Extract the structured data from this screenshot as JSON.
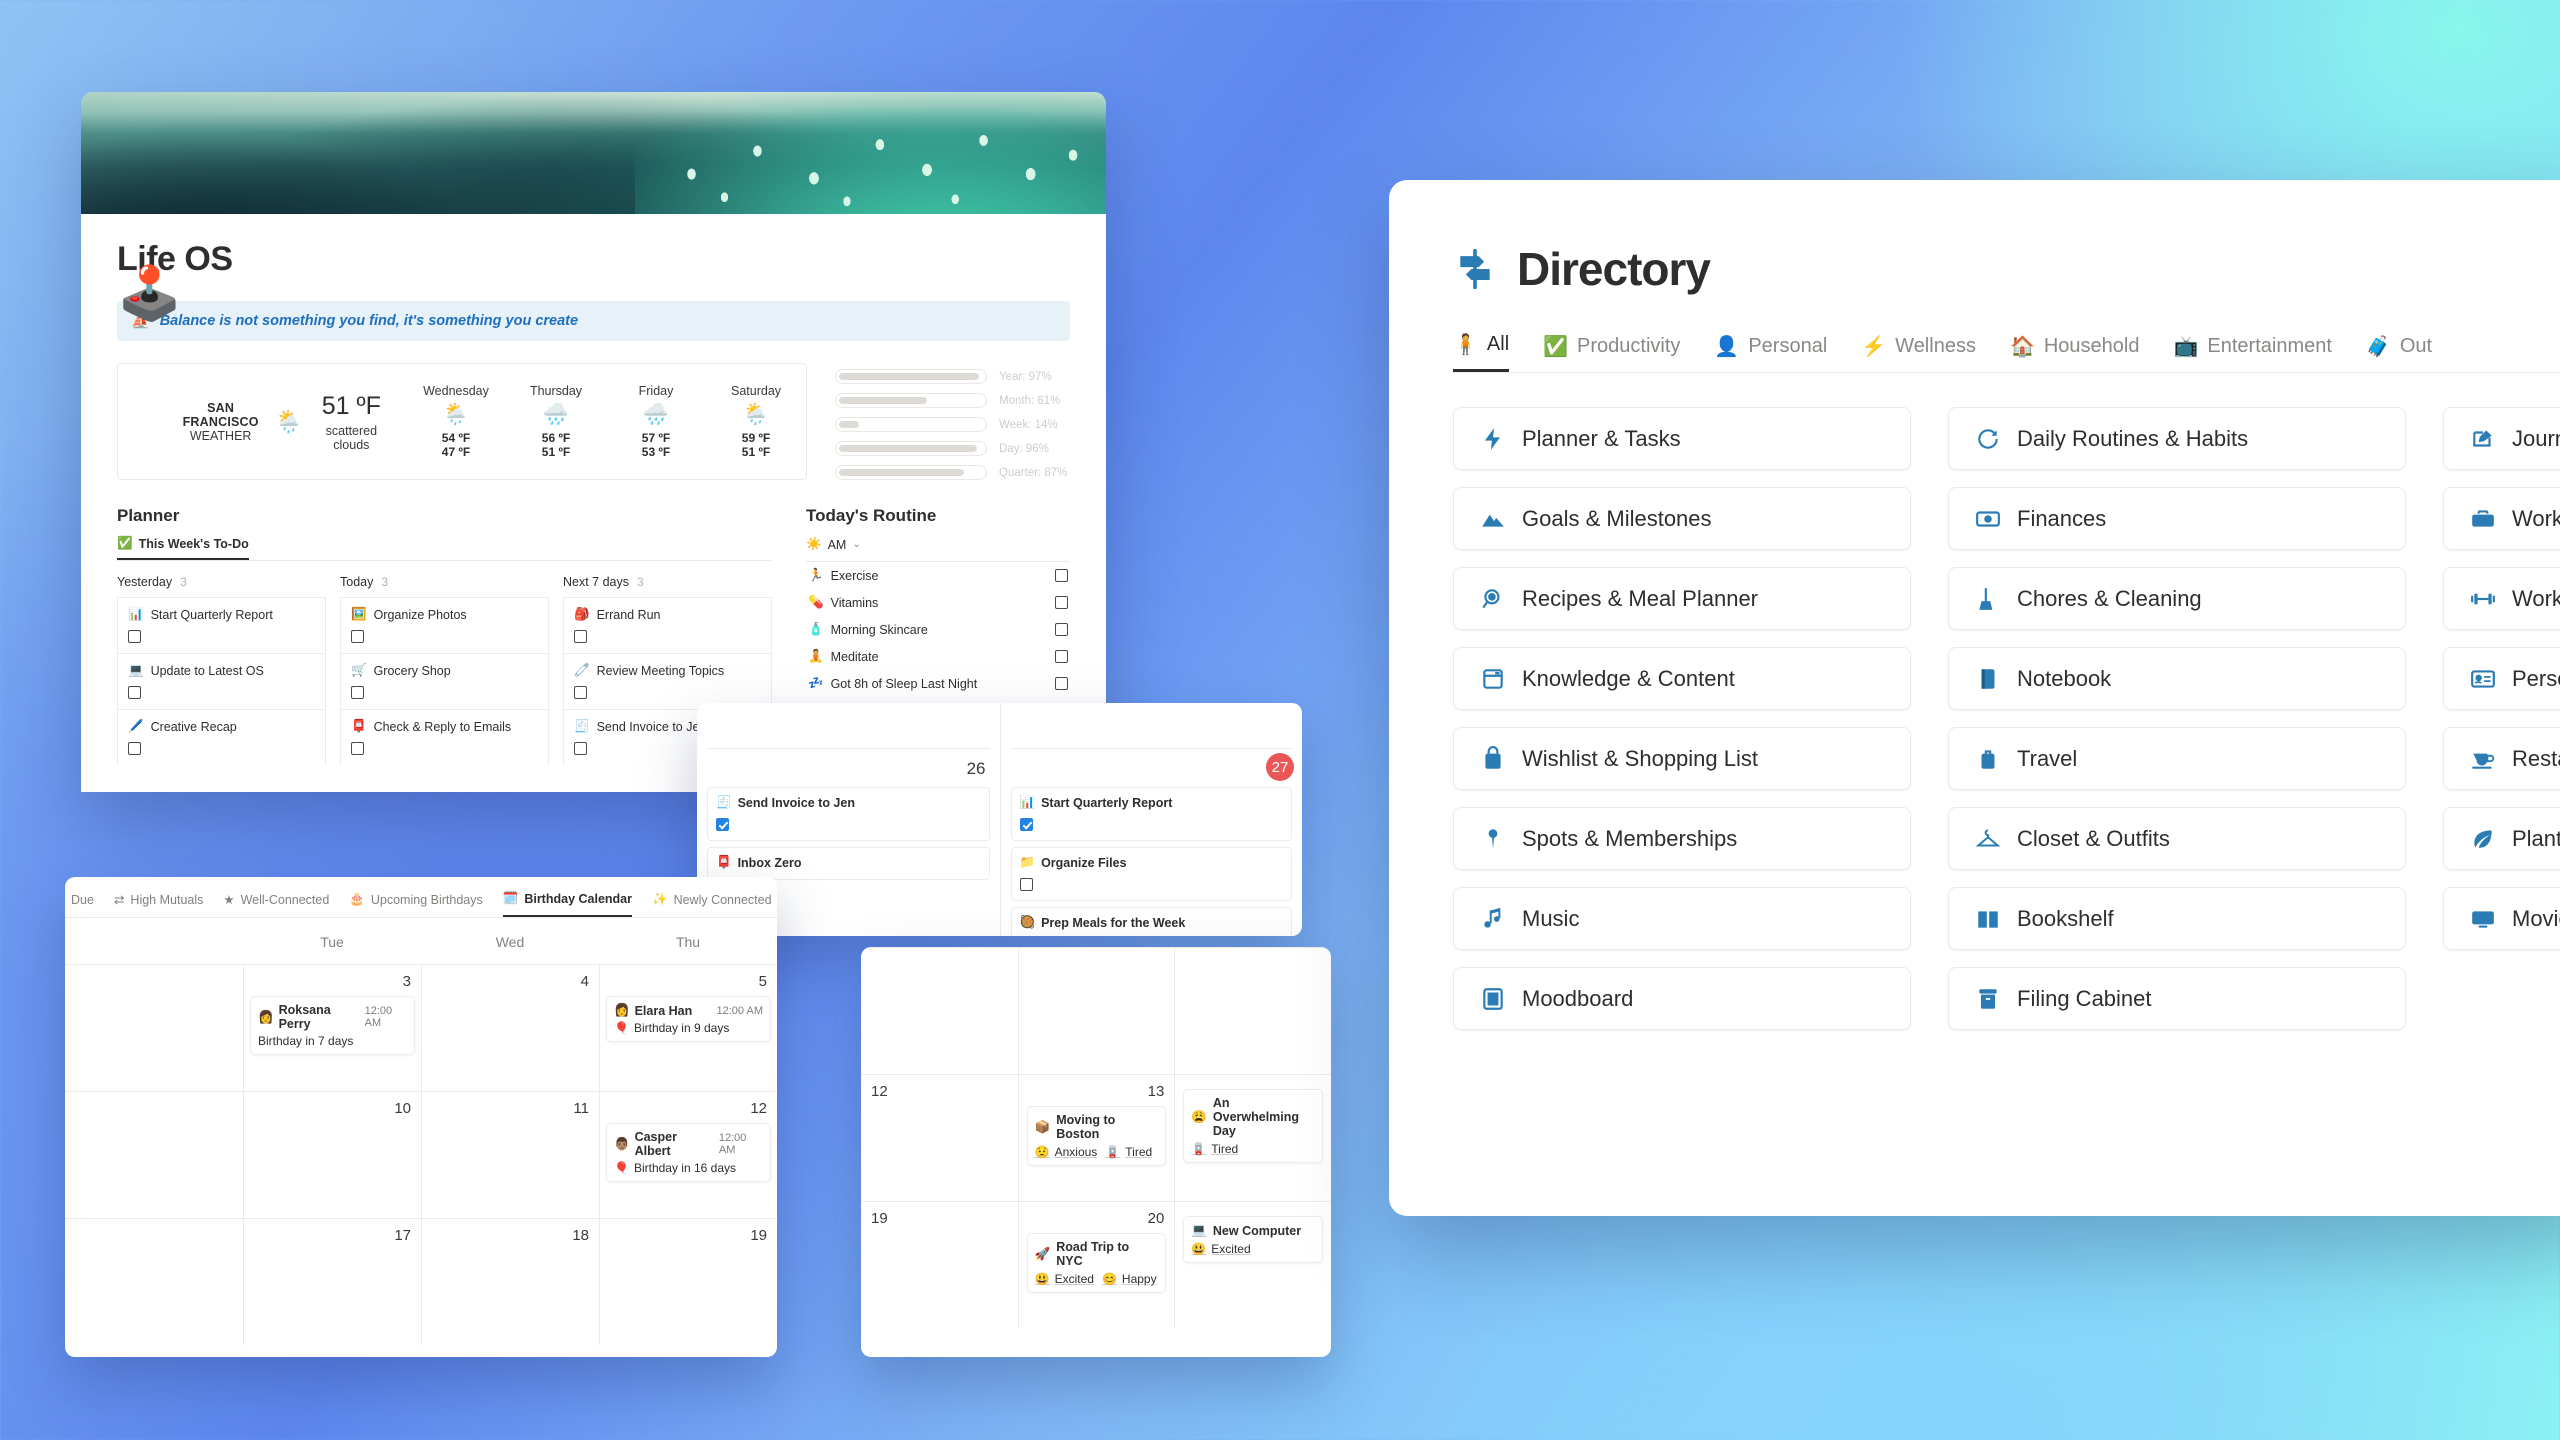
{
  "background": {
    "from": "#8fc3f3",
    "mid": "#5d87ef",
    "to": "#8ffaf0"
  },
  "lifeos": {
    "title": "Life OS",
    "cover_icon": "joystick-icon",
    "callout": {
      "icon": "boat-icon",
      "text": "Balance is not something you find, it's something you create"
    },
    "weather": {
      "city": "SAN FRANCISCO",
      "label": "WEATHER",
      "now_icon": "sun-behind-rain-cloud-icon",
      "temperature": "51 ºF",
      "description": "scattered clouds",
      "forecast": [
        {
          "day": "Wednesday",
          "icon": "sun-behind-rain-cloud-icon",
          "high": "54 ºF",
          "low": "47 ºF"
        },
        {
          "day": "Thursday",
          "icon": "rain-cloud-icon",
          "high": "56 ºF",
          "low": "51 ºF"
        },
        {
          "day": "Friday",
          "icon": "rain-cloud-icon",
          "high": "57 ºF",
          "low": "53 ºF"
        },
        {
          "day": "Saturday",
          "icon": "sun-behind-rain-cloud-icon",
          "high": "59 ºF",
          "low": "51 ºF"
        }
      ]
    },
    "progress": [
      {
        "label": "Year: 97%",
        "percent": 97
      },
      {
        "label": "Month: 61%",
        "percent": 61
      },
      {
        "label": "Week: 14%",
        "percent": 14
      },
      {
        "label": "Day: 96%",
        "percent": 96
      },
      {
        "label": "Quarter: 87%",
        "percent": 87
      }
    ],
    "planner": {
      "title": "Planner",
      "tab": {
        "icon": "check-circle-icon",
        "label": "This Week's To-Do"
      },
      "columns": [
        {
          "name": "Yesterday",
          "count": "3",
          "tasks": [
            {
              "icon": "bar-chart-icon",
              "label": "Start Quarterly Report",
              "checked": false
            },
            {
              "icon": "computer-icon",
              "label": "Update to Latest OS",
              "checked": false
            },
            {
              "icon": "pen-icon",
              "label": "Creative Recap",
              "checked": false
            }
          ]
        },
        {
          "name": "Today",
          "count": "3",
          "tasks": [
            {
              "icon": "framed-picture-icon",
              "label": "Organize Photos",
              "checked": false
            },
            {
              "icon": "shopping-cart-icon",
              "label": "Grocery Shop",
              "checked": false
            },
            {
              "icon": "mailbox-icon",
              "label": "Check & Reply to Emails",
              "checked": false
            }
          ]
        },
        {
          "name": "Next 7 days",
          "count": "3",
          "tasks": [
            {
              "icon": "backpack-icon",
              "label": "Errand Run",
              "checked": false
            },
            {
              "icon": "memo-icon",
              "label": "Review Meeting Topics",
              "checked": false
            },
            {
              "icon": "receipt-icon",
              "label": "Send Invoice to Jen",
              "checked": false
            }
          ]
        }
      ]
    },
    "routine": {
      "title": "Today's Routine",
      "selector": {
        "icon": "sun-icon",
        "label": "AM",
        "chevron": "chevron-down-icon"
      },
      "items": [
        {
          "icon": "running-icon",
          "label": "Exercise",
          "checked": false
        },
        {
          "icon": "pill-icon",
          "label": "Vitamins",
          "checked": false
        },
        {
          "icon": "lotion-icon",
          "label": "Morning Skincare",
          "checked": false
        },
        {
          "icon": "meditation-icon",
          "label": "Meditate",
          "checked": false
        },
        {
          "icon": "sleep-icon",
          "label": "Got 8h of Sleep Last Night",
          "checked": false
        }
      ]
    }
  },
  "week_calendar": {
    "days": [
      {
        "number": "26",
        "is_today": false,
        "events": [
          {
            "icon": "receipt-icon",
            "label": "Send Invoice to Jen",
            "checked": true
          },
          {
            "icon": "mailbox-icon",
            "label": "Inbox Zero",
            "checked": false
          }
        ]
      },
      {
        "number": "27",
        "is_today": true,
        "events": [
          {
            "icon": "bar-chart-icon",
            "label": "Start Quarterly Report",
            "checked": true
          },
          {
            "icon": "folder-icon",
            "label": "Organize Files",
            "checked": false
          },
          {
            "icon": "cooking-icon",
            "label": "Prep Meals for the Week",
            "checked": false
          }
        ]
      }
    ]
  },
  "birthday_calendar": {
    "tabs": [
      {
        "icon": "",
        "label": "Due",
        "active": false
      },
      {
        "icon": "shuffle-icon",
        "label": "High Mutuals",
        "active": false
      },
      {
        "icon": "star-icon",
        "label": "Well-Connected",
        "active": false
      },
      {
        "icon": "cake-icon",
        "label": "Upcoming Birthdays",
        "active": false
      },
      {
        "icon": "calendar-icon",
        "label": "Birthday Calendar",
        "active": true
      },
      {
        "icon": "sparkle-icon",
        "label": "Newly Connected",
        "active": false
      }
    ],
    "day_names": [
      "",
      "Tue",
      "Wed",
      "Thu"
    ],
    "cells": [
      {
        "number": "",
        "events": []
      },
      {
        "number": "3",
        "events": [
          {
            "avatar": "woman-avatar",
            "name": "Roksana Perry",
            "time": "12:00 AM",
            "note_icon": "",
            "note": "Birthday in 7 days"
          }
        ]
      },
      {
        "number": "4",
        "events": []
      },
      {
        "number": "5",
        "events": [
          {
            "avatar": "woman-avatar",
            "name": "Elara Han",
            "time": "12:00 AM",
            "note_icon": "balloon-icon",
            "note": "Birthday in 9 days"
          }
        ]
      },
      {
        "number": "",
        "events": []
      },
      {
        "number": "10",
        "events": []
      },
      {
        "number": "11",
        "events": []
      },
      {
        "number": "12",
        "events": [
          {
            "avatar": "man-avatar",
            "name": "Casper Albert",
            "time": "12:00 AM",
            "note_icon": "balloon-icon",
            "note": "Birthday in 16 days"
          }
        ]
      },
      {
        "number": "",
        "events": []
      },
      {
        "number": "17",
        "events": []
      },
      {
        "number": "18",
        "events": []
      },
      {
        "number": "19",
        "events": []
      }
    ]
  },
  "mood_calendar": {
    "cells": [
      {
        "number": "",
        "lead": false,
        "events": []
      },
      {
        "number": "",
        "lead": false,
        "events": []
      },
      {
        "number": "",
        "lead": false,
        "events": []
      },
      {
        "number": "12",
        "lead": true,
        "events": []
      },
      {
        "number": "13",
        "lead": false,
        "events": [
          {
            "icon": "package-icon",
            "label": "Moving to Boston",
            "tags": [
              {
                "icon": "anxious-icon",
                "label": "Anxious"
              },
              {
                "icon": "tired-icon",
                "label": "Tired"
              }
            ]
          }
        ]
      },
      {
        "number": "",
        "lead": false,
        "events": [
          {
            "icon": "weary-face-icon",
            "label": "An Overwhelming Day",
            "tags": [
              {
                "icon": "tired-icon",
                "label": "Tired"
              }
            ]
          }
        ]
      },
      {
        "number": "19",
        "lead": true,
        "events": []
      },
      {
        "number": "20",
        "lead": false,
        "events": [
          {
            "icon": "rocket-icon",
            "label": "Road Trip to NYC",
            "tags": [
              {
                "icon": "excited-icon",
                "label": "Excited"
              },
              {
                "icon": "happy-icon",
                "label": "Happy"
              }
            ]
          }
        ]
      },
      {
        "number": "",
        "lead": false,
        "events": [
          {
            "icon": "computer-icon",
            "label": "New Computer",
            "tags": [
              {
                "icon": "excited-icon",
                "label": "Excited"
              }
            ]
          }
        ]
      }
    ]
  },
  "directory": {
    "icon": "signpost-icon",
    "title": "Directory",
    "accent": "#2b7cb5",
    "tabs": [
      {
        "icon": "person-icon",
        "label": "All",
        "active": true
      },
      {
        "icon": "check-badge-icon",
        "label": "Productivity",
        "active": false
      },
      {
        "icon": "bust-icon",
        "label": "Personal",
        "active": false
      },
      {
        "icon": "bolt-icon",
        "label": "Wellness",
        "active": false
      },
      {
        "icon": "house-icon",
        "label": "Household",
        "active": false
      },
      {
        "icon": "tv-icon",
        "label": "Entertainment",
        "active": false
      },
      {
        "icon": "luggage-icon",
        "label": "Out",
        "active": false
      }
    ],
    "cards": [
      {
        "icon": "bolt-icon",
        "label": "Planner & Tasks"
      },
      {
        "icon": "refresh-icon",
        "label": "Daily Routines & Habits"
      },
      {
        "icon": "pencil-square-icon",
        "label": "Journal & Mood"
      },
      {
        "icon": "mountain-icon",
        "label": "Goals & Milestones"
      },
      {
        "icon": "money-icon",
        "label": "Finances"
      },
      {
        "icon": "briefcase-icon",
        "label": "Work & Career"
      },
      {
        "icon": "magnifier-icon",
        "label": "Recipes & Meal Planner"
      },
      {
        "icon": "broom-icon",
        "label": "Chores & Cleaning"
      },
      {
        "icon": "dumbbell-icon",
        "label": "Workouts"
      },
      {
        "icon": "window-icon",
        "label": "Knowledge & Content"
      },
      {
        "icon": "book-icon",
        "label": "Notebook"
      },
      {
        "icon": "contact-card-icon",
        "label": "Personal CRM"
      },
      {
        "icon": "bag-icon",
        "label": "Wishlist & Shopping List"
      },
      {
        "icon": "suitcase-icon",
        "label": "Travel"
      },
      {
        "icon": "coffee-icon",
        "label": "Restaurants, Cafes & Bars"
      },
      {
        "icon": "pin-icon",
        "label": "Spots & Memberships"
      },
      {
        "icon": "hanger-icon",
        "label": "Closet & Outfits"
      },
      {
        "icon": "leaf-icon",
        "label": "Plant Care"
      },
      {
        "icon": "music-note-icon",
        "label": "Music"
      },
      {
        "icon": "open-book-icon",
        "label": "Bookshelf"
      },
      {
        "icon": "monitor-icon",
        "label": "Movies & TV"
      },
      {
        "icon": "image-icon",
        "label": "Moodboard"
      },
      {
        "icon": "archive-icon",
        "label": "Filing Cabinet"
      }
    ]
  }
}
